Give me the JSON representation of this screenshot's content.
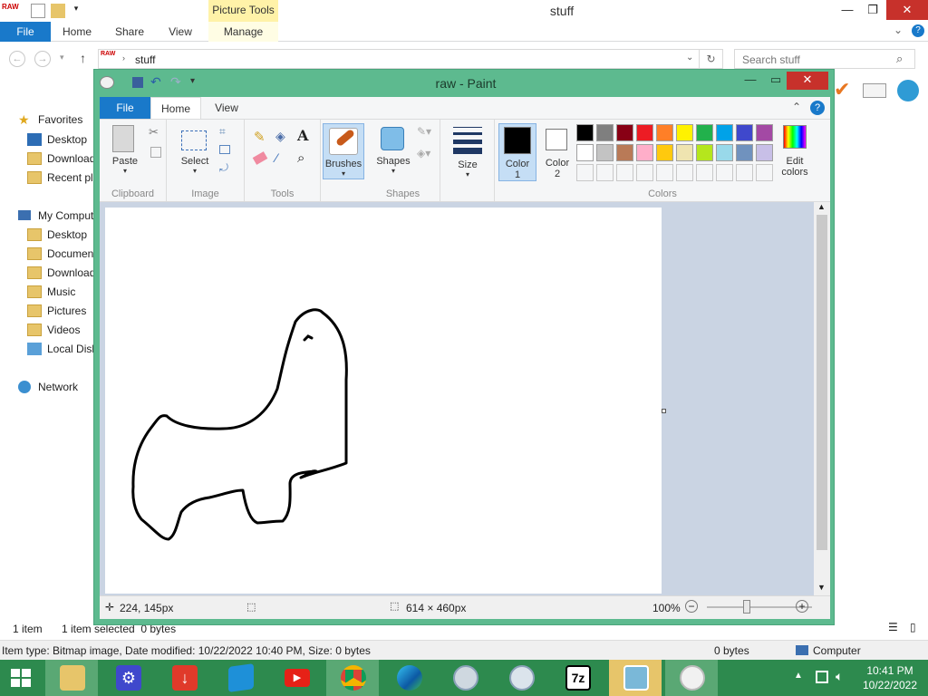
{
  "explorer": {
    "title": "stuff",
    "context_tab": "Picture Tools",
    "tabs": {
      "file": "File",
      "home": "Home",
      "share": "Share",
      "view": "View",
      "manage": "Manage"
    },
    "address": "stuff",
    "search_placeholder": "Search stuff",
    "nav": {
      "favorites": "Favorites",
      "fav_items": [
        "Desktop",
        "Downloads",
        "Recent places"
      ],
      "computer": "My Computer",
      "computer_items": [
        "Desktop",
        "Documents",
        "Downloads",
        "Music",
        "Pictures",
        "Videos",
        "Local Disk"
      ],
      "network": "Network"
    },
    "status": {
      "count": "1 item",
      "selected": "1 item selected  0 bytes"
    },
    "details": {
      "info": "Item type: Bitmap image, Date modified: 10/22/2022 10:40 PM, Size: 0 bytes",
      "size": "0 bytes",
      "location": "Computer"
    }
  },
  "paint": {
    "title": "raw - Paint",
    "tabs": {
      "file": "File",
      "home": "Home",
      "view": "View"
    },
    "groups": {
      "clipboard": "Clipboard",
      "image": "Image",
      "tools": "Tools",
      "shapes": "Shapes",
      "colors": "Colors"
    },
    "buttons": {
      "paste": "Paste",
      "select": "Select",
      "brushes": "Brushes",
      "shapes": "Shapes",
      "size": "Size",
      "color1": "Color\n1",
      "color2": "Color\n2",
      "edit_colors": "Edit\ncolors"
    },
    "color1_value": "#000000",
    "color2_value": "#ffffff",
    "palette_row1": [
      "#000000",
      "#7f7f7f",
      "#880015",
      "#ed1c24",
      "#ff7f27",
      "#fff200",
      "#22b14c",
      "#00a2e8",
      "#3f48cc",
      "#a349a4"
    ],
    "palette_row2": [
      "#ffffff",
      "#c3c3c3",
      "#b97a57",
      "#ffaec9",
      "#ffc90e",
      "#efe4b0",
      "#b5e61d",
      "#99d9ea",
      "#7092be",
      "#c8bfe7"
    ],
    "status": {
      "cursor": "224, 145px",
      "size": "614 × 460px",
      "zoom": "100%"
    }
  },
  "taskbar": {
    "time": "10:41 PM",
    "date": "10/22/2022",
    "apps": [
      "start",
      "file-explorer",
      "settings",
      "download-manager",
      "windows-store",
      "youtube",
      "chrome",
      "edge",
      "media-player",
      "optical-disc",
      "7zip",
      "photo-viewer",
      "paint"
    ]
  }
}
